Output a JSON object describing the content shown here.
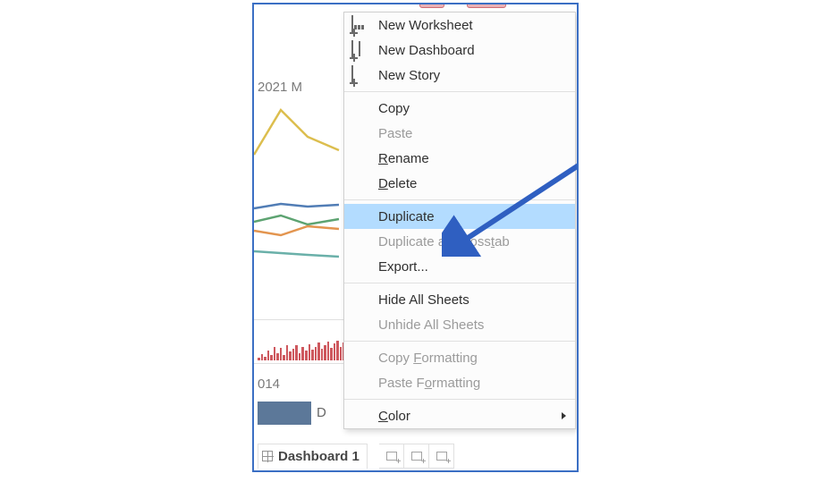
{
  "background": {
    "axis_label_fragment": "2021 M",
    "year_fragment": "014",
    "legend_letter": "D",
    "sheet_tab_label": "Dashboard 1"
  },
  "context_menu": {
    "new_worksheet": "New Worksheet",
    "new_dashboard": "New Dashboard",
    "new_story": "New Story",
    "copy": "Copy",
    "paste": "Paste",
    "rename_pre": "",
    "rename_ul": "R",
    "rename_post": "ename",
    "delete_pre": "",
    "delete_ul": "D",
    "delete_post": "elete",
    "duplicate": "Duplicate",
    "dup_cross_pre": "Duplicate as Cross",
    "dup_cross_ul": "t",
    "dup_cross_post": "ab",
    "export": "Export...",
    "hide_all": "Hide All Sheets",
    "unhide_all": "Unhide All Sheets",
    "copy_fmt_pre": "Copy ",
    "copy_fmt_ul": "F",
    "copy_fmt_post": "ormatting",
    "paste_fmt_pre": "Paste F",
    "paste_fmt_ul": "o",
    "paste_fmt_post": "rmatting",
    "color_pre": "",
    "color_ul": "C",
    "color_post": "olor"
  },
  "annotation": {
    "arrow_color": "#2f5fc1"
  },
  "chart_data": {
    "type": "line",
    "note": "Only partial left edge of a multi-series line chart is visible behind the menu; values below are rough y-positions (0-100 scale, higher = higher on chart) read from the visible pixels for the few x-steps shown.",
    "x": [
      0,
      1,
      2,
      3
    ],
    "series": [
      {
        "name": "yellow",
        "color": "#d9b73b",
        "values": [
          55,
          80,
          60,
          null
        ]
      },
      {
        "name": "blue",
        "color": "#3f6fae",
        "values": [
          25,
          28,
          26,
          27
        ]
      },
      {
        "name": "green",
        "color": "#4c9a62",
        "values": [
          18,
          22,
          17,
          20
        ]
      },
      {
        "name": "orange",
        "color": "#e08a3d",
        "values": [
          12,
          10,
          15,
          13
        ]
      },
      {
        "name": "teal",
        "color": "#5aa8a0",
        "values": [
          6,
          5,
          4,
          3
        ]
      }
    ]
  }
}
